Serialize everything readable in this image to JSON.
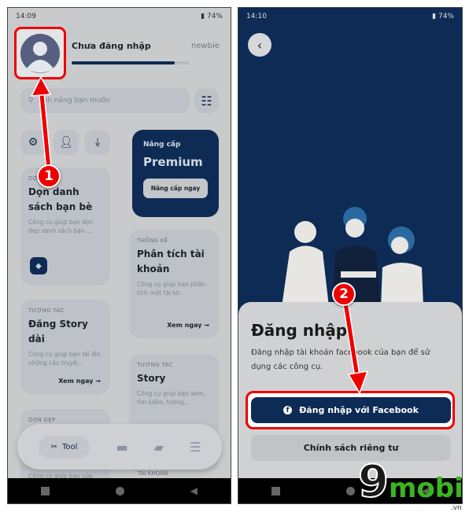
{
  "left": {
    "status": {
      "time": "14:09",
      "battery": "74%"
    },
    "header": {
      "title": "Chưa đăng nhập",
      "level": "newbie",
      "progress": 0.87
    },
    "search": {
      "placeholder": "tính năng bạn muốn"
    },
    "premium": {
      "label": "Nâng cấp",
      "title": "Premium",
      "button": "Nâng cấp ngay"
    },
    "cards": [
      {
        "category": "DỌ",
        "title": "Dọn danh sách bạn bè",
        "desc": "Công cụ giúp bạn dọn dẹp danh sách bạn ..."
      },
      {
        "category": "THỐNG KÊ",
        "title": "Phân tích tài khoản",
        "desc": "Công cụ giúp bạn phân tích một tài kh...",
        "more": "Xem ngay →"
      },
      {
        "category": "TƯƠNG TÁC",
        "title": "Đăng Story dài",
        "desc": "Công cụ giúp bạn tải lên những câu truyệ...",
        "more": "Xem ngay →"
      },
      {
        "category": "TƯƠNG TÁC",
        "title": "Story",
        "desc": "Công cụ giúp bạn xem, tìm kiếm, tương..."
      },
      {
        "category": "DỌN DẸP",
        "title": "",
        "desc": "Công cụ giúp bạn sửa sang lại trang c..."
      },
      {
        "category": "TÀI KHOẢN",
        "title": "",
        "desc": ""
      }
    ],
    "bottom_nav": {
      "tool_label": "Tool"
    }
  },
  "right": {
    "status": {
      "time": "14:10",
      "battery": "74%"
    },
    "sheet": {
      "title": "Đăng nhập",
      "desc": "Đăng nhập tài khoản facebook của bạn để sử dụng các công cụ.",
      "facebook_button": "Đăng nhập với Facebook",
      "privacy_button": "Chính sách riêng tư"
    }
  },
  "annotations": {
    "step1": "1",
    "step2": "2"
  },
  "watermark": {
    "text": "mobi",
    "suffix": ".vn",
    "digit": "9"
  },
  "colors": {
    "navy": "#0d2b55",
    "annotation_red": "#e00000",
    "watermark_green": "#3cb521"
  }
}
